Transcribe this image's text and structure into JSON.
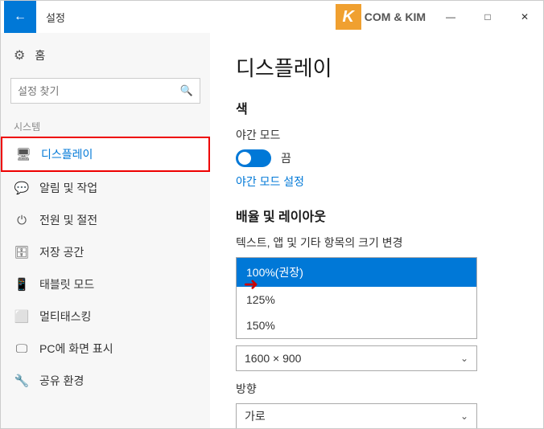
{
  "window": {
    "title": "설정",
    "controls": {
      "minimize": "—",
      "maximize": "□",
      "close": "✕"
    }
  },
  "brand": {
    "letter": "K",
    "text": "COM & KIM"
  },
  "sidebar": {
    "home_label": "홈",
    "search_placeholder": "설정 찾기",
    "section_label": "시스템",
    "nav_items": [
      {
        "id": "display",
        "label": "디스플레이",
        "active": true
      },
      {
        "id": "notifications",
        "label": "알림 및 작업",
        "active": false
      },
      {
        "id": "power",
        "label": "전원 및 절전",
        "active": false
      },
      {
        "id": "storage",
        "label": "저장 공간",
        "active": false
      },
      {
        "id": "tablet",
        "label": "태블릿 모드",
        "active": false
      },
      {
        "id": "multitasking",
        "label": "멀티태스킹",
        "active": false
      },
      {
        "id": "pc-display",
        "label": "PC에 화면 표시",
        "active": false
      },
      {
        "id": "sharing",
        "label": "공유 환경",
        "active": false
      }
    ]
  },
  "main": {
    "page_title": "디스플레이",
    "color_section": {
      "title": "색",
      "night_mode_label": "야간 모드",
      "toggle_state": "끔",
      "night_mode_link": "야간 모드 설정"
    },
    "scale_section": {
      "title": "배율 및 레이아웃",
      "subtitle": "텍스트, 앱 및 기타 항목의 크기 변경",
      "options": [
        {
          "label": "100%(권장)",
          "selected": true
        },
        {
          "label": "125%",
          "selected": false
        },
        {
          "label": "150%",
          "selected": false
        }
      ]
    },
    "resolution_section": {
      "current_value": "1600 × 900"
    },
    "orientation_section": {
      "title": "방향",
      "current_value": "가로"
    }
  }
}
